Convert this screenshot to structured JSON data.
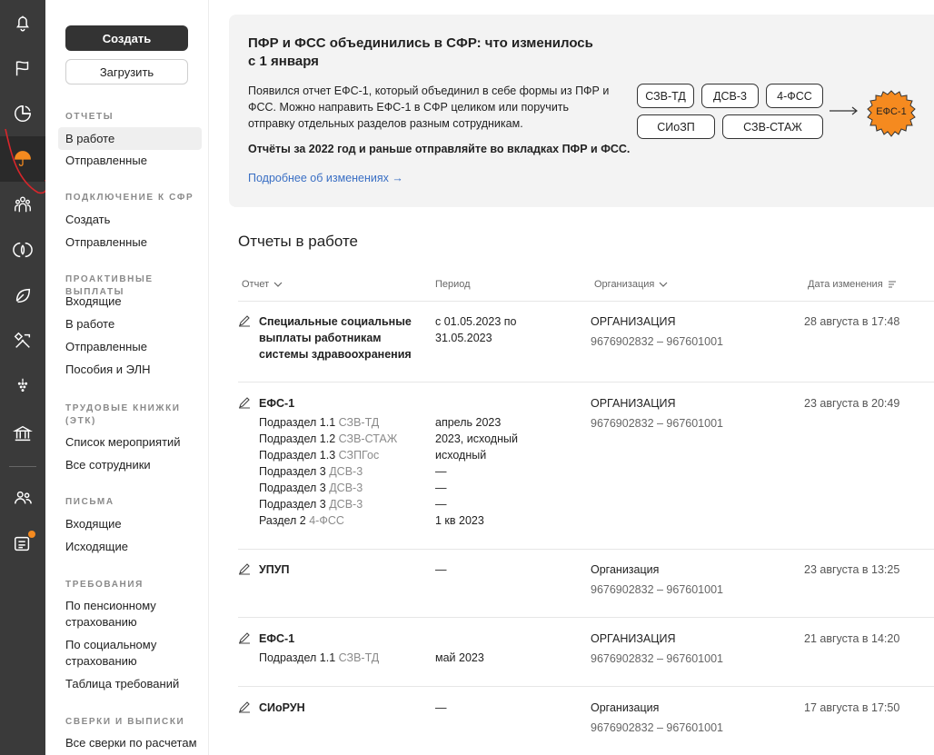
{
  "sidebar": {
    "create_label": "Создать",
    "upload_label": "Загрузить",
    "sections": [
      {
        "title": "ОТЧЕТЫ",
        "items": [
          "В работе",
          "Отправленные"
        ]
      },
      {
        "title": "ПОДКЛЮЧЕНИЕ К СФР",
        "items": [
          "Создать",
          "Отправленные"
        ]
      },
      {
        "title": "ПРОАКТИВНЫЕ ВЫПЛАТЫ",
        "items": [
          "Входящие",
          "В работе",
          "Отправленные",
          "Пособия и ЭЛН"
        ]
      },
      {
        "title": "ТРУДОВЫЕ КНИЖКИ (ЭТК)",
        "items": [
          "Список мероприятий",
          "Все сотрудники"
        ]
      },
      {
        "title": "ПИСЬМА",
        "items": [
          "Входящие",
          "Исходящие"
        ]
      },
      {
        "title": "ТРЕБОВАНИЯ",
        "items": [
          "По пенсионному страхованию",
          "По социальному страхованию",
          "Таблица требований"
        ]
      },
      {
        "title": "СВЕРКИ И ВЫПИСКИ",
        "items": [
          "Все сверки по расчетам"
        ]
      }
    ]
  },
  "banner": {
    "title": "ПФР и ФСС объединились в СФР: что изменилось с 1 января",
    "text": "Появился отчет ЕФС-1, который объединил в себе формы из ПФР и ФСС. Можно направить ЕФС-1 в СФР целиком или поручить отправку отдельных разделов разным сотрудникам.",
    "note": "Отчёты за 2022 год и раньше отправляйте во вкладках ПФР и ФСС.",
    "link": "Подробнее об изменениях →",
    "chips": [
      "СЗВ-ТД",
      "ДСВ-3",
      "4-ФСС",
      "СИоЗП",
      "СЗВ-СТАЖ"
    ],
    "result": "ЕФС-1"
  },
  "main": {
    "title": "Отчеты в работе",
    "columns": {
      "report": "Отчет",
      "period": "Период",
      "org": "Организация",
      "date": "Дата изменения"
    },
    "rows": [
      {
        "name": "Специальные социальные выплаты работникам системы здравоохранения",
        "period": "с 01.05.2023 по 31.05.2023",
        "org": "ОРГАНИЗАЦИЯ",
        "inn": "9676902832 – 967601001",
        "date": "28 августа в 17:48",
        "subs": []
      },
      {
        "name": "ЕФС-1",
        "period": "",
        "org": "ОРГАНИЗАЦИЯ",
        "inn": "9676902832 – 967601001",
        "date": "23 августа в 20:49",
        "subs": [
          {
            "label": "Подраздел 1.1",
            "form": "СЗВ-ТД",
            "period": "апрель 2023"
          },
          {
            "label": "Подраздел 1.2",
            "form": "СЗВ-СТАЖ",
            "period": "2023, исходный"
          },
          {
            "label": "Подраздел 1.3",
            "form": "СЗПГос",
            "period": "исходный"
          },
          {
            "label": "Подраздел 3",
            "form": "ДСВ-3",
            "period": "—"
          },
          {
            "label": "Подраздел 3",
            "form": "ДСВ-3",
            "period": "—"
          },
          {
            "label": "Подраздел 3",
            "form": "ДСВ-3",
            "period": "—"
          },
          {
            "label": "Раздел 2",
            "form": "4-ФСС",
            "period": "1 кв 2023"
          }
        ]
      },
      {
        "name": "УПУП",
        "period": "—",
        "org": "Организация",
        "inn": "9676902832 – 967601001",
        "date": "23 августа в 13:25",
        "subs": []
      },
      {
        "name": "ЕФС-1",
        "period": "",
        "org": "ОРГАНИЗАЦИЯ",
        "inn": "9676902832 – 967601001",
        "date": "21 августа в 14:20",
        "subs": [
          {
            "label": "Подраздел 1.1",
            "form": "СЗВ-ТД",
            "period": "май 2023"
          }
        ]
      },
      {
        "name": "СИоРУН",
        "period": "—",
        "org": "Организация",
        "inn": "9676902832 – 967601001",
        "date": "17 августа в 17:50",
        "subs": []
      }
    ]
  },
  "colors": {
    "rail": "#3a3a3a",
    "accent": "#f58a1f",
    "link": "#3a6fc4",
    "annotation": "#d8262b"
  },
  "rail_icons": [
    "bell-icon",
    "flag-icon",
    "pie-chart-icon",
    "umbrella-icon",
    "people-icon",
    "leaf-circle-icon",
    "leaf-icon",
    "tools-icon",
    "grapes-icon",
    "bank-icon",
    "users-icon",
    "news-icon"
  ]
}
